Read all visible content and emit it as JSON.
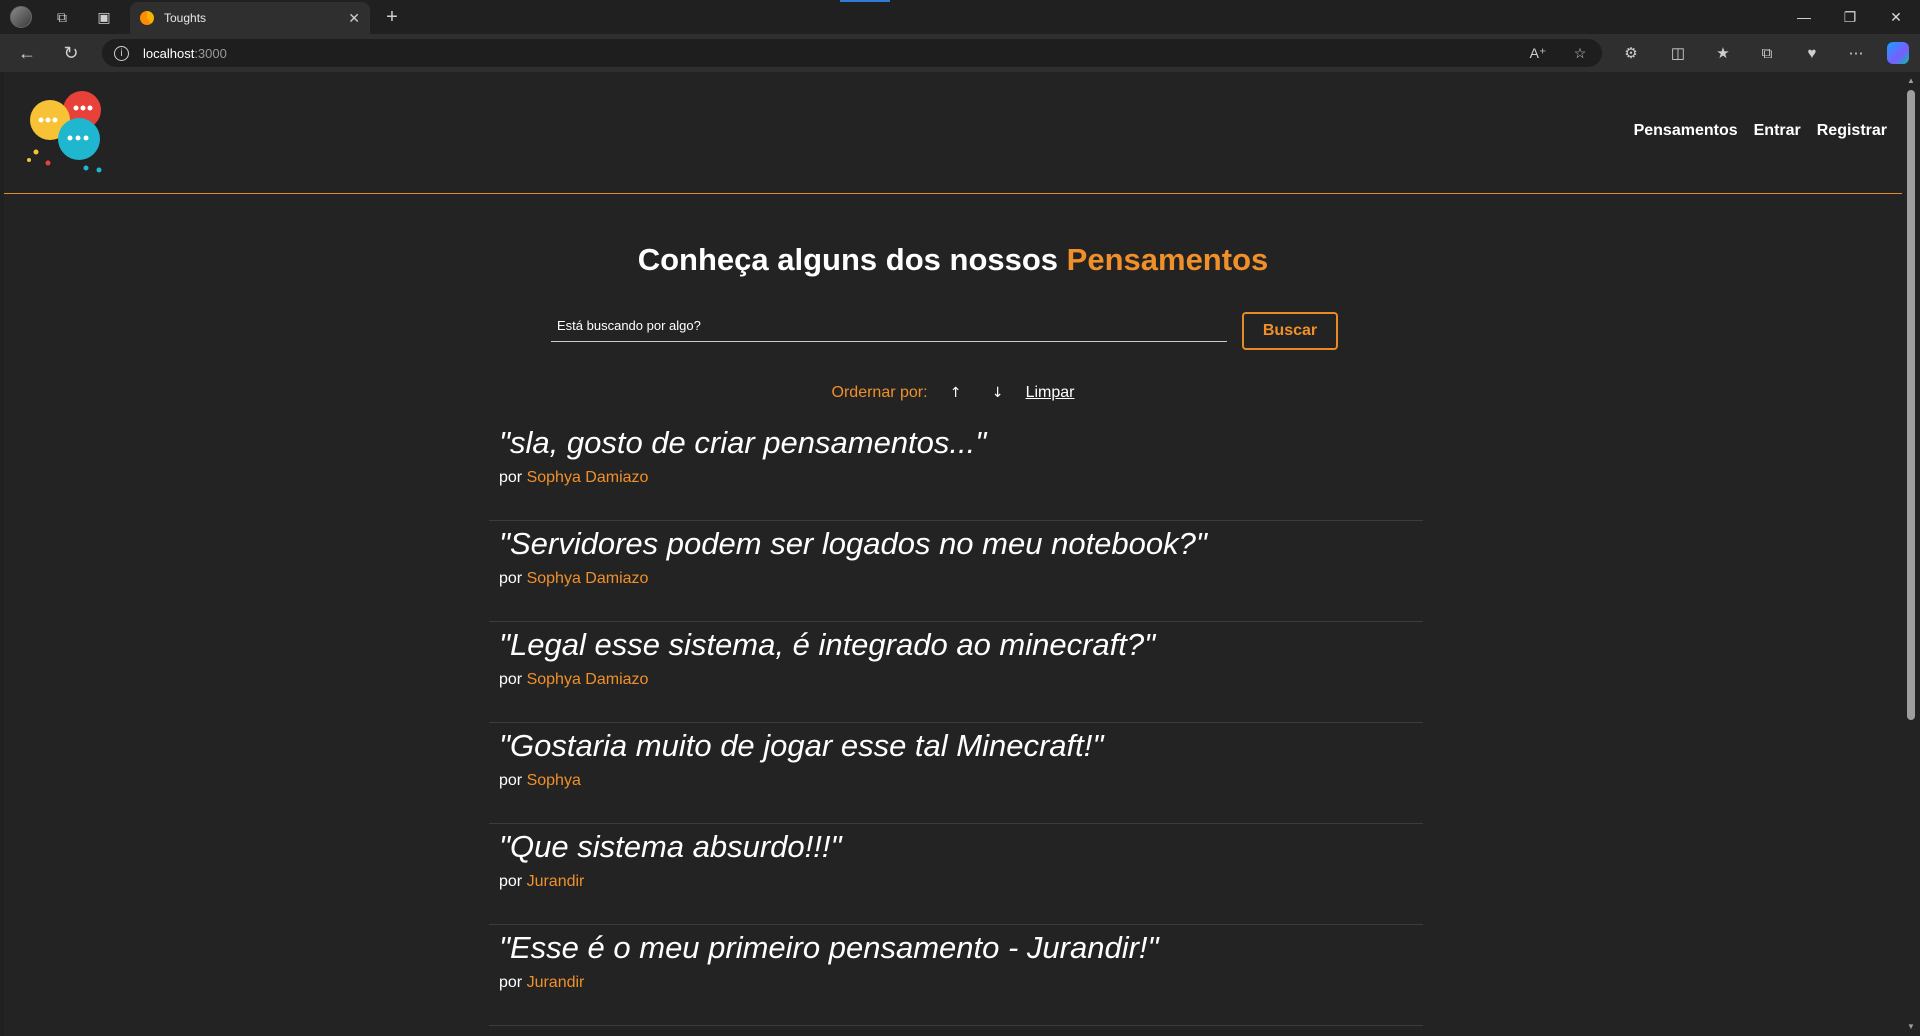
{
  "browser": {
    "tab_title": "Toughts",
    "new_tab": "+",
    "url_host": "localhost",
    "url_port": ":3000"
  },
  "header": {
    "nav": [
      "Pensamentos",
      "Entrar",
      "Registrar"
    ]
  },
  "main": {
    "title_prefix": "Conheça alguns dos nossos",
    "title_accent": "Pensamentos",
    "search_placeholder": "Está buscando por algo?",
    "search_button": "Buscar",
    "order_label": "Ordernar por:",
    "order_up": "↑",
    "order_down": "↓",
    "clear": "Limpar",
    "by_label": "por"
  },
  "thoughts": [
    {
      "text": "\"sla, gosto de criar pensamentos...\"",
      "author": "Sophya Damiazo"
    },
    {
      "text": "\"Servidores podem ser logados no meu notebook?\"",
      "author": "Sophya Damiazo"
    },
    {
      "text": "\"Legal esse sistema, é integrado ao minecraft?\"",
      "author": "Sophya Damiazo"
    },
    {
      "text": "\"Gostaria muito de jogar esse tal Minecraft!\"",
      "author": "Sophya"
    },
    {
      "text": "\"Que sistema absurdo!!!\"",
      "author": "Jurandir"
    },
    {
      "text": "\"Esse é o meu primeiro pensamento - Jurandir!\"",
      "author": "Jurandir"
    }
  ],
  "colors": {
    "accent": "#f0902a",
    "background": "#232323",
    "text": "#ffffff"
  }
}
